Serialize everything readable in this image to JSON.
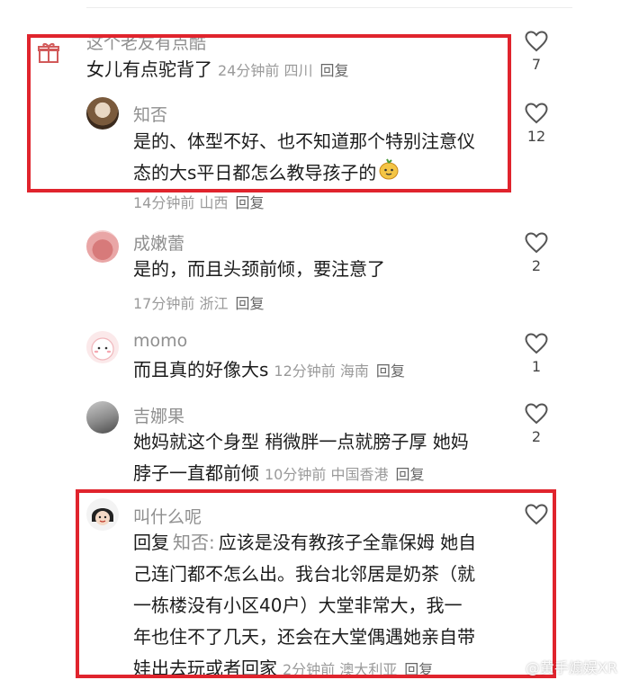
{
  "comments": [
    {
      "username": "这个老友有点酷",
      "text": "女儿有点驼背了",
      "time": "24分钟前",
      "location": "四川",
      "reply_label": "回复",
      "likes": "7"
    },
    {
      "username": "知否",
      "text_lines": [
        "是的、体型不好、也不知道那个特别注意仪",
        "态的大s平日都怎么教导孩子的"
      ],
      "time": "14分钟前",
      "location": "山西",
      "reply_label": "回复",
      "likes": "12"
    },
    {
      "username": "成嫩蕾",
      "text": "是的，而且头颈前倾，要注意了",
      "time": "17分钟前",
      "location": "浙江",
      "reply_label": "回复",
      "likes": "2"
    },
    {
      "username": "momo",
      "text": "而且真的好像大s",
      "time": "12分钟前",
      "location": "海南",
      "reply_label": "回复",
      "likes": "1"
    },
    {
      "username": "吉娜果",
      "text_lines": [
        "她妈就这个身型 稍微胖一点就膀子厚 她妈",
        "脖子一直都前倾"
      ],
      "time": "10分钟前",
      "location": "中国香港",
      "reply_label": "回复",
      "likes": "2"
    },
    {
      "username": "叫什么呢",
      "reply_prefix": "回复",
      "reply_target": "知否:",
      "text_lines": [
        "应该是没有教孩子全靠保姆 她自",
        "己连门都不怎么出。我台北邻居是奶茶（就",
        "一栋楼没有小区40户）大堂非常大，我一",
        "年也住不了几天，还会在大堂偶遇她亲自带",
        "娃出去玩或者回家"
      ],
      "time": "2分钟前",
      "location": "澳大利亚",
      "reply_label": "回复",
      "likes": ""
    }
  ],
  "watermark": "@黄手煽娱XR",
  "colors": {
    "highlight_box": "#e0242d",
    "meta": "#9a9a9a",
    "username": "#8f8f8f"
  },
  "icons": {
    "like": "heart-outline-icon",
    "gift": "gift-icon",
    "emoji": "mango-face-emoji"
  }
}
